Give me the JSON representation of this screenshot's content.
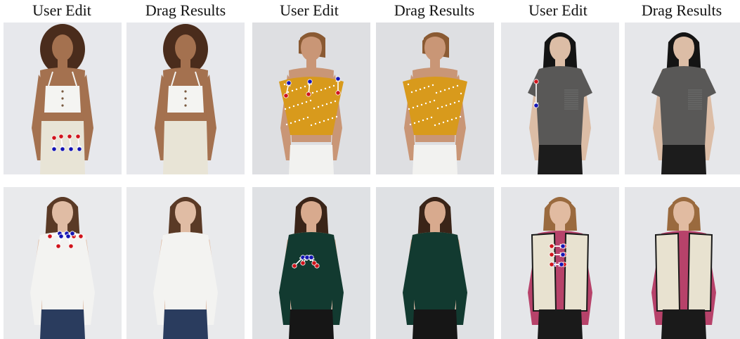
{
  "headers": [
    "User Edit",
    "Drag Results",
    "User Edit",
    "Drag Results",
    "User Edit",
    "Drag Results"
  ],
  "colors": {
    "handle": "#d0141c",
    "target": "#1414b4",
    "arrow": "#ffffff"
  },
  "rows": [
    [
      {
        "subject": "woman-white-crop-top",
        "bg": "#e7e8ec",
        "skin": "#a4714f",
        "hair": "#4a2c1c",
        "hair_style": "afro",
        "top": "#f4f4f2",
        "top_style": "crop",
        "bottom": "#e8e4d6",
        "handles": true
      },
      {
        "subject": "woman-white-crop-top",
        "bg": "#e7e8ec",
        "skin": "#a4714f",
        "hair": "#4a2c1c",
        "hair_style": "afro",
        "top": "#f4f4f2",
        "top_style": "crop",
        "bottom": "#e8e4d6",
        "handles": false
      },
      {
        "subject": "woman-mustard-polka-top",
        "bg": "#dedfe2",
        "skin": "#c99676",
        "hair": "#8a5a33",
        "hair_style": "short",
        "top": "#d89a1c",
        "top_style": "offshoulder",
        "bottom": "#f2f2f0",
        "handles": true
      },
      {
        "subject": "woman-mustard-polka-top",
        "bg": "#dedfe2",
        "skin": "#c99676",
        "hair": "#8a5a33",
        "hair_style": "short",
        "top": "#d89a1c",
        "top_style": "offshoulder",
        "bottom": "#f2f2f0",
        "handles": false
      },
      {
        "subject": "woman-grey-tshirt",
        "bg": "#e6e7ea",
        "skin": "#dcbda6",
        "hair": "#141414",
        "hair_style": "long",
        "top": "#595857",
        "top_style": "tee",
        "bottom": "#1c1c1c",
        "handles": true
      },
      {
        "subject": "woman-grey-tshirt",
        "bg": "#e6e7ea",
        "skin": "#dcbda6",
        "hair": "#141414",
        "hair_style": "long",
        "top": "#595857",
        "top_style": "tee",
        "bottom": "#1c1c1c",
        "handles": false
      }
    ],
    [
      {
        "subject": "woman-white-longsleeve",
        "bg": "#e9eaec",
        "skin": "#e0bca4",
        "hair": "#5a3a26",
        "hair_style": "long",
        "top": "#f3f3f1",
        "top_style": "longsleeve",
        "bottom": "#2a3c5e",
        "handles": true
      },
      {
        "subject": "woman-white-longsleeve",
        "bg": "#e9eaec",
        "skin": "#e0bca4",
        "hair": "#5a3a26",
        "hair_style": "long",
        "top": "#f3f3f1",
        "top_style": "longsleeve",
        "bottom": "#2a3c5e",
        "handles": false
      },
      {
        "subject": "woman-green-bodysuit",
        "bg": "#dfe1e4",
        "skin": "#d8aa8e",
        "hair": "#3a2418",
        "hair_style": "long",
        "top": "#123a30",
        "top_style": "longsleeve",
        "bottom": "#161616",
        "handles": true
      },
      {
        "subject": "woman-green-bodysuit",
        "bg": "#dfe1e4",
        "skin": "#d8aa8e",
        "hair": "#3a2418",
        "hair_style": "long",
        "top": "#123a30",
        "top_style": "longsleeve",
        "bottom": "#161616",
        "handles": false
      },
      {
        "subject": "woman-fleece-vest",
        "bg": "#e5e6e9",
        "skin": "#e1bba1",
        "hair": "#9a6a3e",
        "hair_style": "bob",
        "top": "#b7426a",
        "top_style": "vest",
        "vest": "#e8e2d0",
        "bottom": "#1a1a1a",
        "handles": true
      },
      {
        "subject": "woman-fleece-vest",
        "bg": "#e5e6e9",
        "skin": "#e1bba1",
        "hair": "#9a6a3e",
        "hair_style": "bob",
        "top": "#b7426a",
        "top_style": "vest",
        "vest": "#e8e2d0",
        "bottom": "#1a1a1a",
        "handles": false
      }
    ]
  ],
  "drag_points": [
    [
      [
        [
          72,
          164,
          72,
          180
        ],
        [
          82,
          162,
          84,
          180
        ],
        [
          94,
          162,
          96,
          180
        ],
        [
          106,
          162,
          108,
          180
        ]
      ],
      [],
      [
        [
          48,
          104,
          52,
          86
        ],
        [
          80,
          102,
          82,
          84
        ],
        [
          122,
          100,
          122,
          80
        ]
      ],
      [],
      [
        [
          50,
          84,
          50,
          118
        ]
      ],
      []
    ],
    [
      [
        [
          66,
          70,
          80,
          66
        ],
        [
          100,
          70,
          90,
          66
        ],
        [
          78,
          84,
          82,
          70
        ],
        [
          96,
          84,
          92,
          70
        ],
        [
          110,
          70,
          98,
          66
        ]
      ],
      [],
      [
        [
          60,
          112,
          72,
          100
        ],
        [
          92,
          112,
          82,
          100
        ],
        [
          72,
          108,
          78,
          100
        ],
        [
          88,
          108,
          84,
          100
        ]
      ],
      [],
      [
        [
          90,
          84,
          72,
          84
        ],
        [
          90,
          96,
          72,
          96
        ],
        [
          90,
          110,
          74,
          110
        ],
        [
          72,
          84,
          88,
          84
        ],
        [
          72,
          96,
          88,
          96
        ],
        [
          72,
          110,
          86,
          110
        ]
      ],
      []
    ]
  ]
}
